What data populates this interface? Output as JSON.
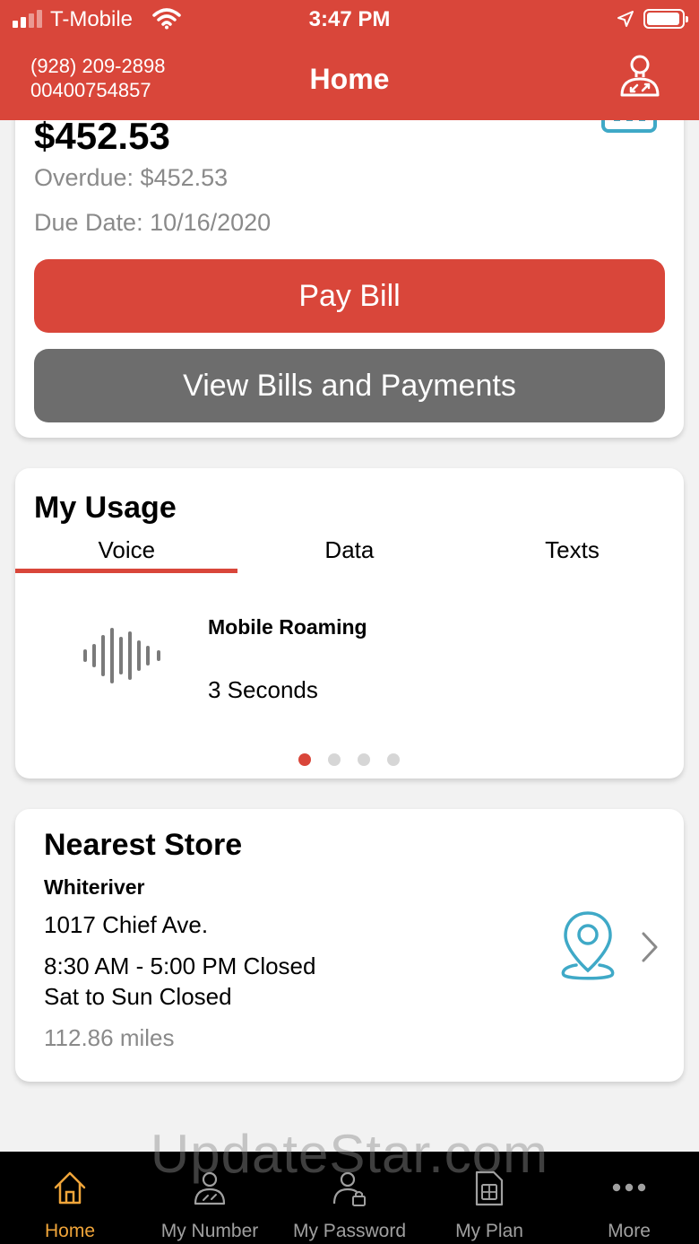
{
  "status": {
    "carrier": "T-Mobile",
    "time": "3:47 PM"
  },
  "header": {
    "phone": "(928) 209-2898",
    "account": "00400754857",
    "title": "Home"
  },
  "bill": {
    "amount": "$452.53",
    "overdue": "Overdue: $452.53",
    "due_date": "Due Date: 10/16/2020",
    "pay_label": "Pay Bill",
    "view_label": "View Bills and Payments"
  },
  "usage": {
    "title": "My Usage",
    "tabs": [
      "Voice",
      "Data",
      "Texts"
    ],
    "active_tab": 0,
    "item_type": "Mobile Roaming",
    "item_value": "3 Seconds",
    "pages": 4,
    "active_page": 0
  },
  "store": {
    "title": "Nearest Store",
    "name": "Whiteriver",
    "address": "1017 Chief Ave.",
    "hours": "8:30 AM - 5:00 PM Closed",
    "weekend": "Sat to Sun Closed",
    "distance": "112.86 miles"
  },
  "watermark": "UpdateStar.com",
  "nav": {
    "items": [
      {
        "label": "Home",
        "icon": "home-icon"
      },
      {
        "label": "My Number",
        "icon": "user-icon"
      },
      {
        "label": "My Password",
        "icon": "user-lock-icon"
      },
      {
        "label": "My Plan",
        "icon": "sim-card-icon"
      },
      {
        "label": "More",
        "icon": "more-icon"
      }
    ],
    "active": 0
  },
  "colors": {
    "brand": "#d9463a",
    "accent": "#3fa9c7",
    "nav_active": "#f0a53a",
    "secondary_button": "#6d6d6d"
  }
}
